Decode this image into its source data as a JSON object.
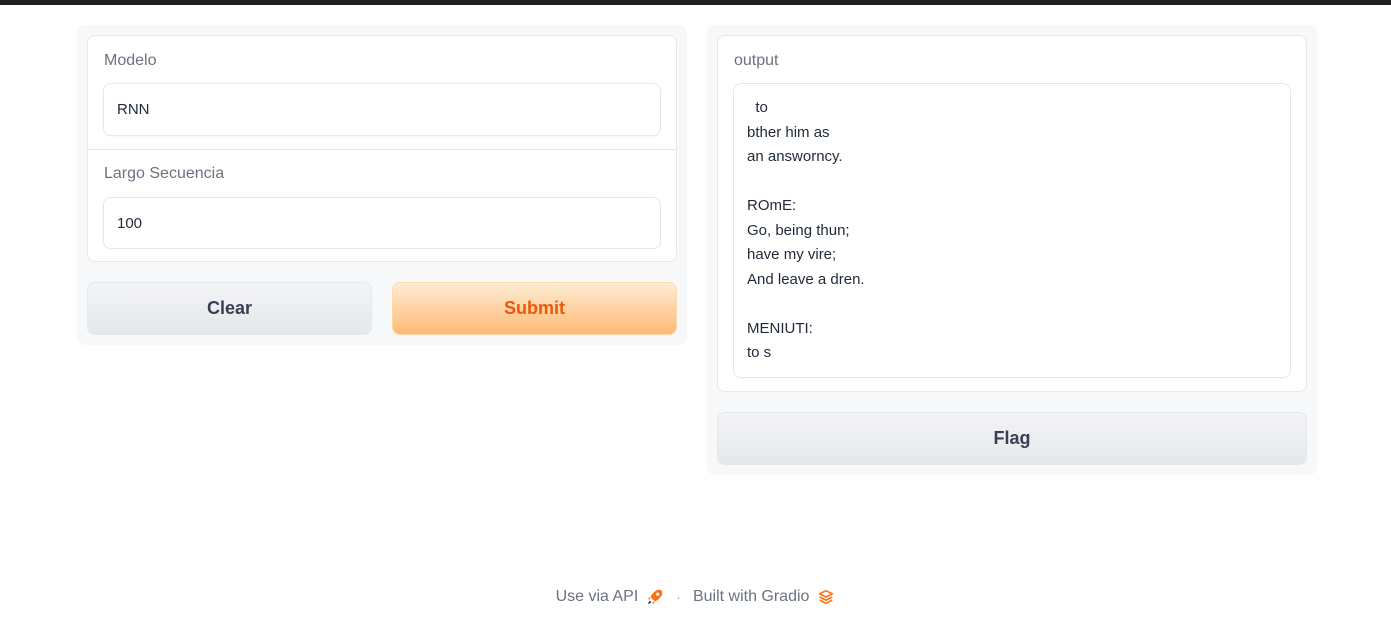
{
  "inputs": {
    "modelo": {
      "label": "Modelo",
      "value": "RNN"
    },
    "largo": {
      "label": "Largo Secuencia",
      "value": "100"
    }
  },
  "buttons": {
    "clear": "Clear",
    "submit": "Submit",
    "flag": "Flag"
  },
  "output": {
    "label": "output",
    "text": "  to\nbther him as\nan answorncy.\n\nROmE:\nGo, being thun;\nhave my vire;\nAnd leave a dren.\n\nMENIUTI:\nto s"
  },
  "footer": {
    "api_label": "Use via API",
    "separator": "·",
    "built_label": "Built with Gradio",
    "api_icon": "rocket-icon",
    "gradio_icon": "gradio-logo-icon"
  },
  "colors": {
    "accent": "#ea580c",
    "submit_gradient_top": "#ffedd5",
    "submit_gradient_bottom": "#fdba74"
  }
}
